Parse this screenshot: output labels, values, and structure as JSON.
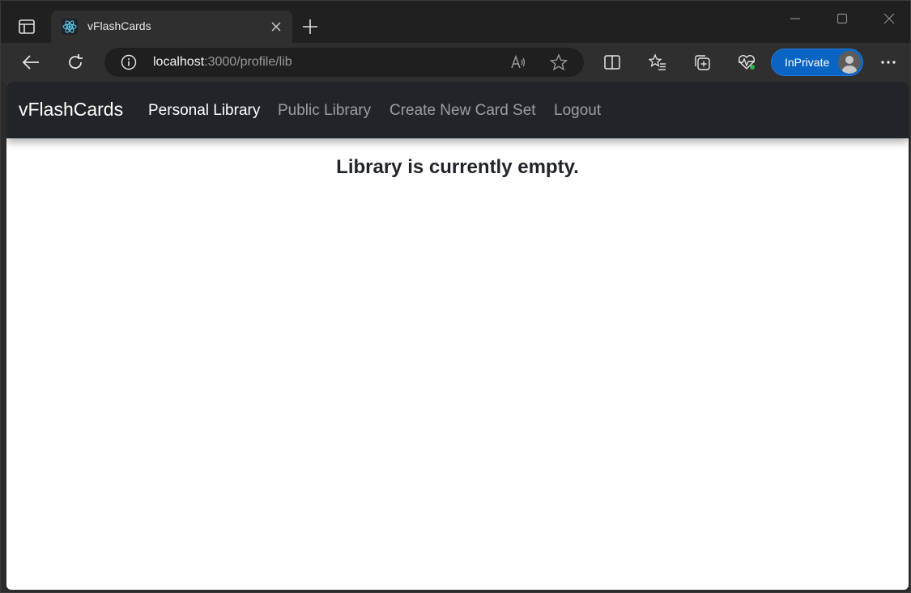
{
  "browser": {
    "tab": {
      "title": "vFlashCards",
      "favicon": "react-icon"
    },
    "address": {
      "host": "localhost",
      "rest": ":3000/profile/lib"
    },
    "inprivate_label": "InPrivate",
    "accent": "#0a64c2"
  },
  "page": {
    "navbar": {
      "brand": "vFlashCards",
      "links": [
        {
          "label": "Personal Library",
          "active": true
        },
        {
          "label": "Public Library",
          "active": false
        },
        {
          "label": "Create New Card Set",
          "active": false
        },
        {
          "label": "Logout",
          "active": false
        }
      ],
      "bg_color": "#212529"
    },
    "empty_message": "Library is currently empty."
  }
}
